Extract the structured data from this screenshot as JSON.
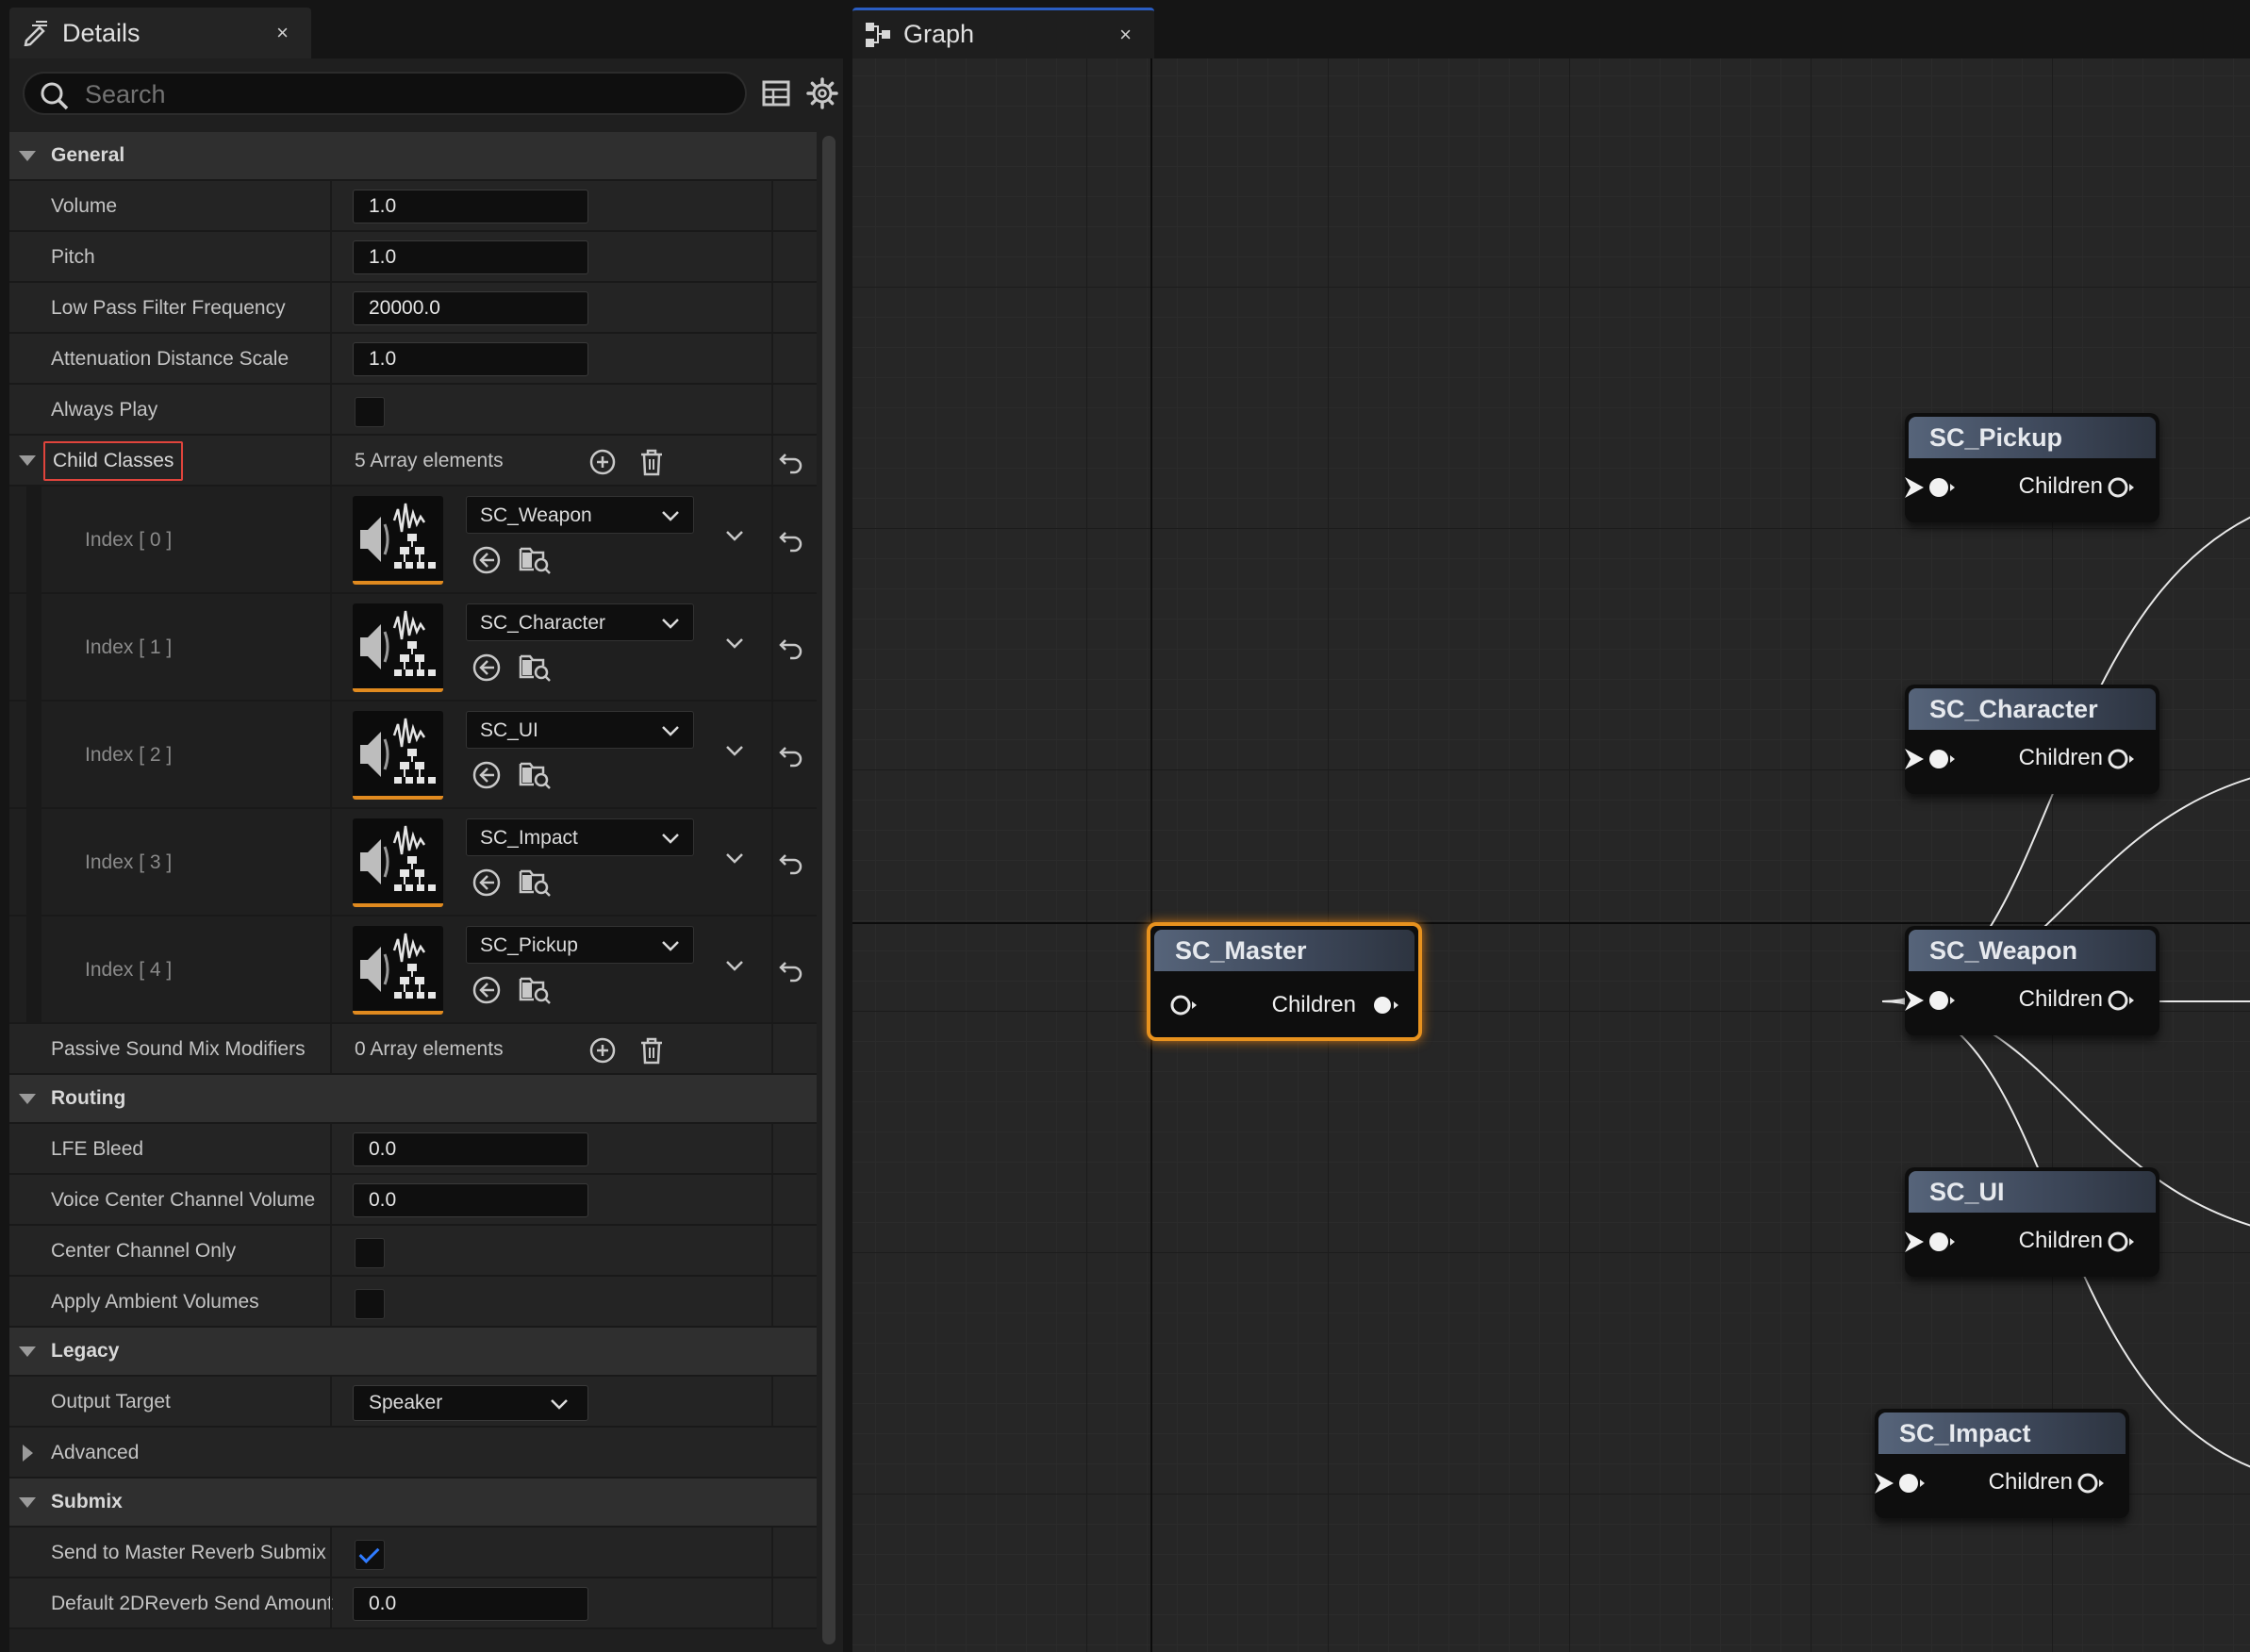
{
  "details": {
    "tab_title": "Details",
    "close_glyph": "×",
    "search_placeholder": "Search",
    "categories": {
      "general": "General",
      "routing": "Routing",
      "legacy": "Legacy",
      "advanced": "Advanced",
      "submix": "Submix"
    },
    "general": {
      "volume_label": "Volume",
      "volume": "1.0",
      "pitch_label": "Pitch",
      "pitch": "1.0",
      "lpf_label": "Low Pass Filter Frequency",
      "lpf": "20000.0",
      "atten_label": "Attenuation Distance Scale",
      "atten": "1.0",
      "always_play_label": "Always Play",
      "always_play": false,
      "child_classes_label": "Child Classes",
      "child_classes_count": "5 Array elements",
      "child_classes": [
        {
          "index": "Index [ 0 ]",
          "value": "SC_Weapon"
        },
        {
          "index": "Index [ 1 ]",
          "value": "SC_Character"
        },
        {
          "index": "Index [ 2 ]",
          "value": "SC_UI"
        },
        {
          "index": "Index [ 3 ]",
          "value": "SC_Impact"
        },
        {
          "index": "Index [ 4 ]",
          "value": "SC_Pickup"
        }
      ],
      "passive_label": "Passive Sound Mix Modifiers",
      "passive_count": "0 Array elements"
    },
    "routing": {
      "lfe_label": "LFE Bleed",
      "lfe": "0.0",
      "voice_center_label": "Voice Center Channel Volume",
      "voice_center": "0.0",
      "center_only_label": "Center Channel Only",
      "center_only": false,
      "ambient_label": "Apply Ambient Volumes",
      "ambient": false
    },
    "legacy": {
      "output_target_label": "Output Target",
      "output_target": "Speaker"
    },
    "submix": {
      "send_reverb_label": "Send to Master Reverb Submix",
      "send_reverb": true,
      "reverb_amount_label": "Default 2DReverb Send Amount",
      "reverb_amount": "0.0"
    }
  },
  "graph": {
    "tab_title": "Graph",
    "close_glyph": "×",
    "nodes": {
      "master": {
        "title": "SC_Master",
        "pin": "Children"
      },
      "pickup": {
        "title": "SC_Pickup",
        "pin": "Children"
      },
      "character": {
        "title": "SC_Character",
        "pin": "Children"
      },
      "weapon": {
        "title": "SC_Weapon",
        "pin": "Children"
      },
      "ui": {
        "title": "SC_UI",
        "pin": "Children"
      },
      "impact": {
        "title": "SC_Impact",
        "pin": "Children"
      }
    }
  },
  "colors": {
    "accent_orange": "#e8921e",
    "highlight_red": "#e0443c",
    "check_blue": "#2f7bff",
    "tab_active_blue": "#2a5dc2"
  },
  "icons": [
    "edit-pencil-icon",
    "search-icon",
    "table-view-icon",
    "settings-gear-icon",
    "add-element-icon",
    "delete-trash-icon",
    "reset-to-default-icon",
    "sound-class-thumbnail-icon",
    "use-selected-asset-icon",
    "browse-to-asset-icon",
    "chevron-down-icon",
    "graph-icon",
    "close-icon"
  ]
}
